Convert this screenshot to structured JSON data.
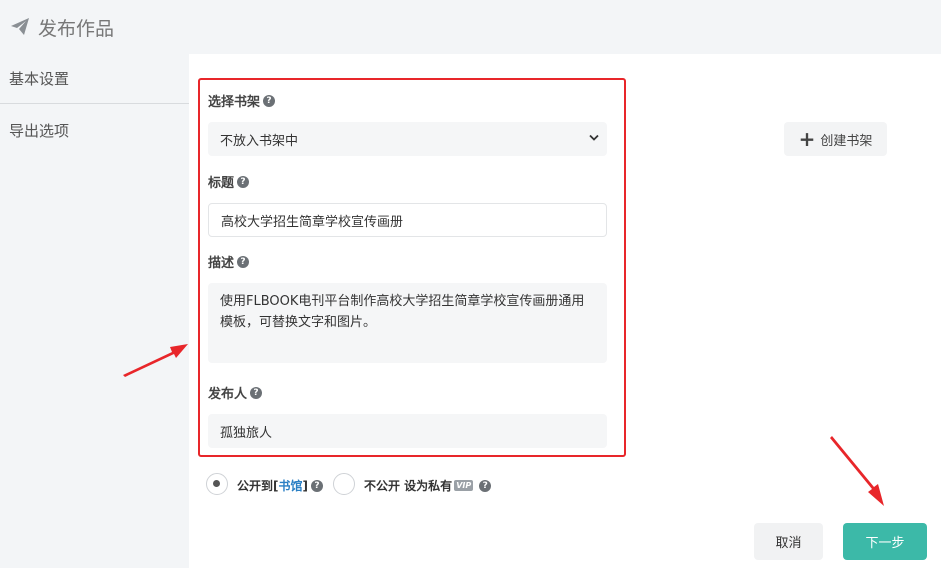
{
  "header": {
    "title": "发布作品",
    "icon": "paper-plane-icon"
  },
  "sidebar": {
    "items": [
      {
        "label": "基本设置"
      },
      {
        "label": "导出选项"
      }
    ]
  },
  "form": {
    "bookshelf": {
      "label": "选择书架",
      "value": "不放入书架中"
    },
    "title": {
      "label": "标题",
      "value": "高校大学招生简章学校宣传画册"
    },
    "description": {
      "label": "描述",
      "value": "使用FLBOOK电刊平台制作高校大学招生简章学校宣传画册通用模板，可替换文字和图片。"
    },
    "publisher": {
      "label": "发布人",
      "value": "孤独旅人"
    },
    "help_glyph": "?"
  },
  "create_shelf": {
    "label": "创建书架"
  },
  "visibility": {
    "public": {
      "prefix": "公开到 ",
      "bracket_open": "[",
      "link": "书馆",
      "bracket_close": "]",
      "checked": true
    },
    "private": {
      "label": "不公开 设为私有",
      "vip_badge": "VIP",
      "checked": false
    }
  },
  "actions": {
    "cancel": "取消",
    "next": "下一步"
  },
  "colors": {
    "accent": "#3cb9a8",
    "highlight_red": "#e8262a",
    "link": "#2a7fc4"
  }
}
